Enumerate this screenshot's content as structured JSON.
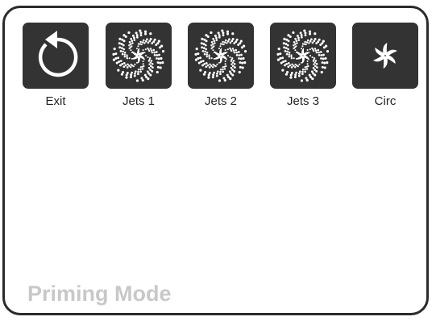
{
  "buttons": [
    {
      "label": "Exit",
      "icon": "exit-icon"
    },
    {
      "label": "Jets 1",
      "icon": "jets-icon"
    },
    {
      "label": "Jets 2",
      "icon": "jets-icon"
    },
    {
      "label": "Jets 3",
      "icon": "jets-icon"
    },
    {
      "label": "Circ",
      "icon": "circ-icon"
    }
  ],
  "mode": {
    "title": "Priming Mode"
  },
  "colors": {
    "tile": "#333333",
    "icon": "#ffffff",
    "border": "#2b2b2b",
    "mode_text": "#c8c8c8"
  }
}
